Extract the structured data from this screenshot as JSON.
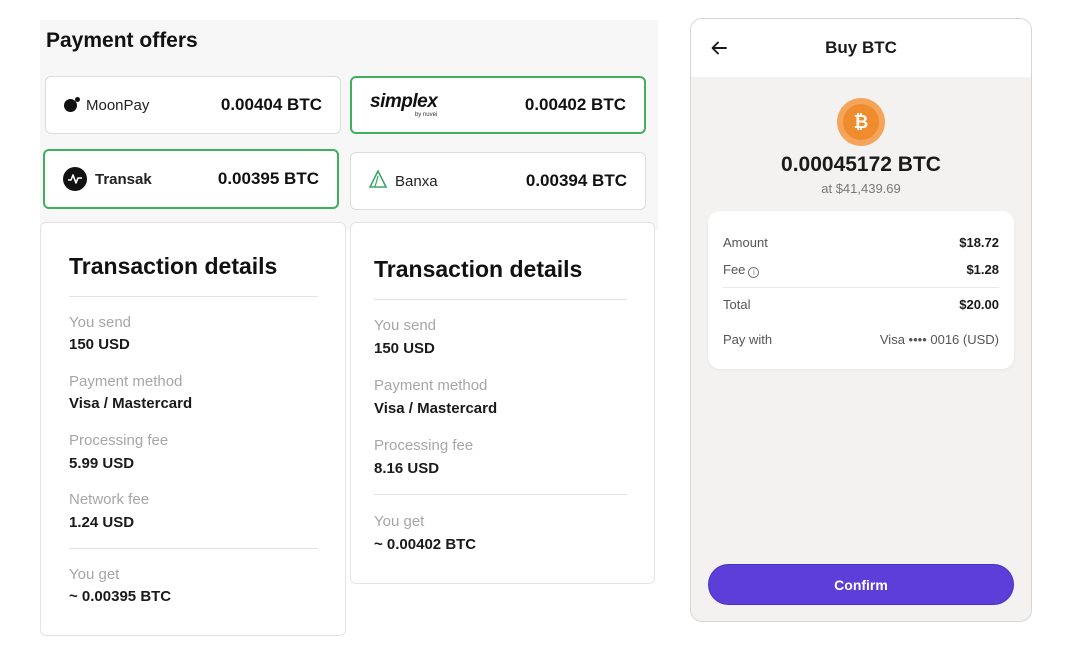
{
  "offers": {
    "title": "Payment offers",
    "items": [
      {
        "provider": "MoonPay",
        "amount": "0.00404 BTC"
      },
      {
        "provider": "simplex",
        "provider_sub": "by nuvei",
        "amount": "0.00402 BTC"
      },
      {
        "provider": "Transak",
        "amount": "0.00395 BTC"
      },
      {
        "provider": "Banxa",
        "amount": "0.00394 BTC"
      }
    ],
    "selected_color": "#3fb05e"
  },
  "tx_left": {
    "title": "Transaction details",
    "rows": [
      {
        "label": "You send",
        "value": "150 USD"
      },
      {
        "label": "Payment method",
        "value": "Visa / Mastercard"
      },
      {
        "label": "Processing fee",
        "value": "5.99 USD"
      },
      {
        "label": "Network fee",
        "value": "1.24 USD"
      },
      {
        "label": "You get",
        "value": "~ 0.00395 BTC"
      }
    ]
  },
  "tx_right": {
    "title": "Transaction details",
    "rows": [
      {
        "label": "You send",
        "value": "150 USD"
      },
      {
        "label": "Payment method",
        "value": "Visa / Mastercard"
      },
      {
        "label": "Processing fee",
        "value": "8.16 USD"
      },
      {
        "label": "You get",
        "value": "~ 0.00402 BTC"
      }
    ]
  },
  "phone": {
    "title": "Buy BTC",
    "coin_symbol": "₿",
    "btc_amount": "0.00045172 BTC",
    "rate": "at $41,439.69",
    "summary": {
      "amount_label": "Amount",
      "amount_value": "$18.72",
      "fee_label": "Fee",
      "fee_value": "$1.28",
      "total_label": "Total",
      "total_value": "$20.00",
      "pay_label": "Pay with",
      "pay_value": "Visa •••• 0016 (USD)"
    },
    "confirm_label": "Confirm",
    "accent": "#5b3fd8",
    "coin_color": "#ef8c2e"
  }
}
